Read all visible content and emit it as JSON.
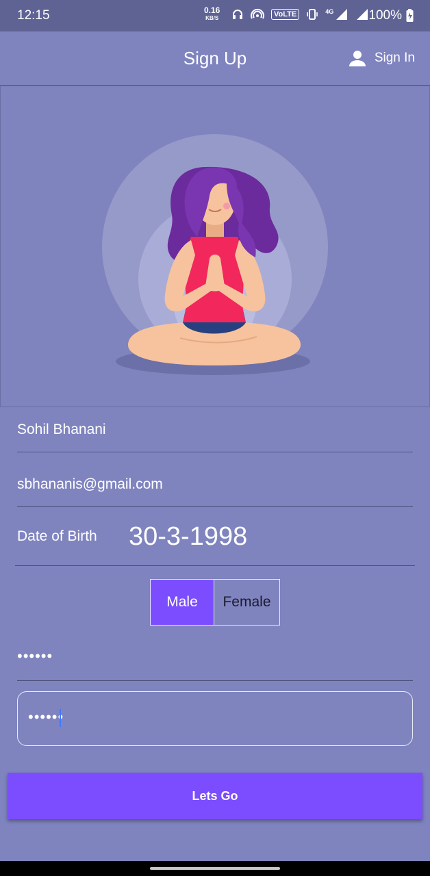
{
  "status_bar": {
    "time": "12:15",
    "net_speed": "0.16",
    "net_unit": "KB/S",
    "volte": "VoLTE",
    "network": "4G",
    "battery": "100%"
  },
  "app_bar": {
    "title": "Sign Up",
    "sign_in_label": "Sign In"
  },
  "form": {
    "name": "Sohil Bhanani",
    "email": "sbhananis@gmail.com",
    "dob_label": "Date of Birth",
    "dob_value": "30-3-1998",
    "gender_options": [
      "Male",
      "Female"
    ],
    "gender_selected": "Male",
    "password": "••••••",
    "confirm_password": "••••••"
  },
  "submit_label": "Lets Go",
  "colors": {
    "background": "#7f84bf",
    "accent": "#7c4dff",
    "status_bar": "#5f6394"
  }
}
